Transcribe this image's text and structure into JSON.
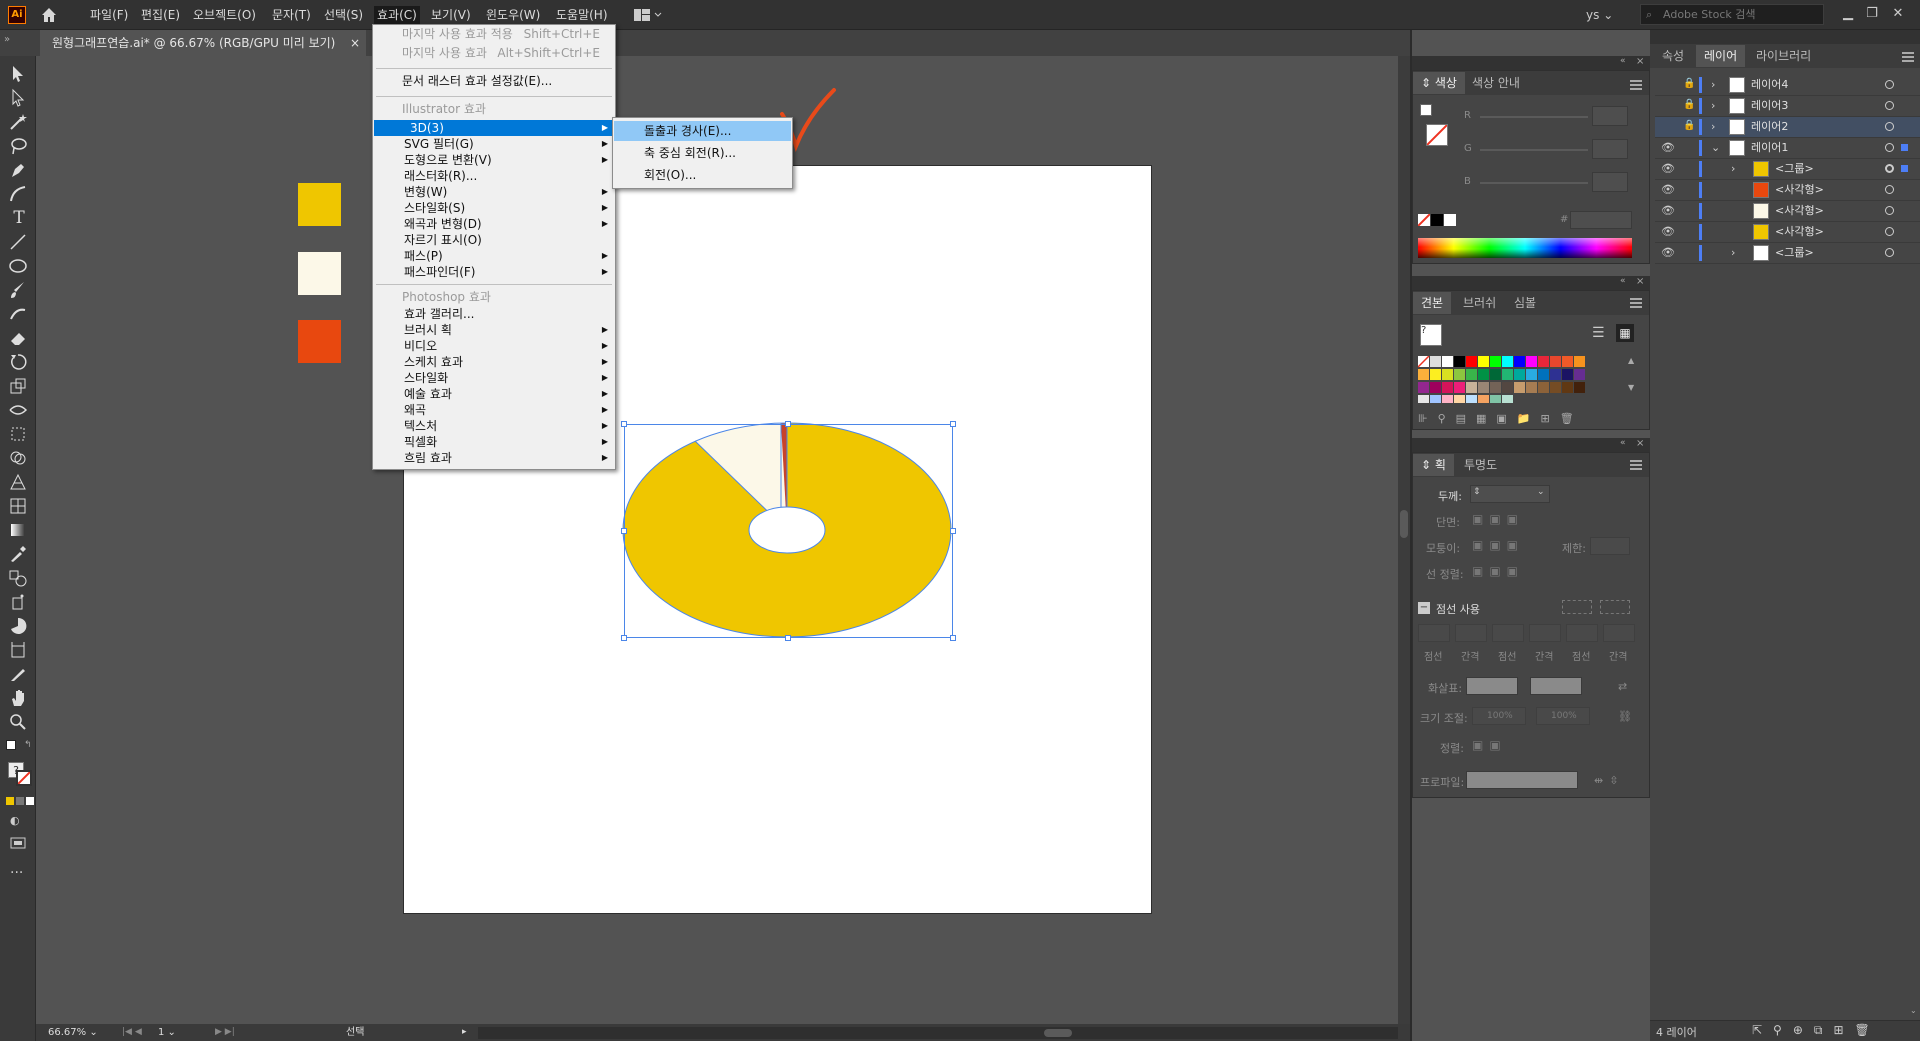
{
  "app": {
    "logo": "Ai"
  },
  "menubar": {
    "items": [
      "파일(F)",
      "편집(E)",
      "오브젝트(O)",
      "문자(T)",
      "선택(S)",
      "효과(C)",
      "보기(V)",
      "윈도우(W)",
      "도움말(H)"
    ],
    "user": "ys",
    "stock_placeholder": "Adobe Stock 검색"
  },
  "document": {
    "tab_title": "원형그래프연습.ai* @ 66.67% (RGB/GPU 미리 보기)"
  },
  "effect_menu": {
    "last_effect_apply": "마지막 사용 효과 적용",
    "last_effect_apply_shortcut": "Shift+Ctrl+E",
    "last_effect": "마지막 사용 효과",
    "last_effect_shortcut": "Alt+Shift+Ctrl+E",
    "raster_settings": "문서 래스터 효과 설정값(E)...",
    "illustrator_header": "Illustrator 효과",
    "illustrator_items": [
      "3D(3)",
      "SVG 필터(G)",
      "도형으로 변환(V)",
      "래스터화(R)...",
      "변형(W)",
      "스타일화(S)",
      "왜곡과 변형(D)",
      "자르기 표시(O)",
      "패스(P)",
      "패스파인더(F)"
    ],
    "photoshop_header": "Photoshop 효과",
    "photoshop_items": [
      "효과 갤러리...",
      "브러시 획",
      "비디오",
      "스케치 효과",
      "스타일화",
      "예술 효과",
      "왜곡",
      "텍스처",
      "픽셀화",
      "흐림 효과"
    ]
  },
  "submenu_3d": {
    "items": [
      "돌출과 경사(E)...",
      "축 중심 회전(R)...",
      "회전(O)..."
    ]
  },
  "color_panel": {
    "tabs": [
      "색상",
      "색상 안내"
    ],
    "channels": [
      "R",
      "G",
      "B"
    ],
    "hex_prefix": "#"
  },
  "swatches_panel": {
    "tabs": [
      "견본",
      "브러쉬",
      "심볼"
    ]
  },
  "stroke_panel": {
    "tabs": [
      "획",
      "투명도"
    ],
    "weight_label": "두께:",
    "cap_label": "단면:",
    "corner_label": "모퉁이:",
    "limit_label": "제한:",
    "align_label": "선 정렬:",
    "dashed_label": "점선 사용",
    "dash_headers": [
      "점선",
      "간격",
      "점선",
      "간격",
      "점선",
      "간격"
    ],
    "arrow_label": "화살표:",
    "scale_label": "크기 조절:",
    "scale_values": [
      "100%",
      "100%"
    ],
    "align2_label": "정렬:",
    "profile_label": "프로파일:"
  },
  "right_top_tabs": [
    "속성",
    "레이어",
    "라이브러리"
  ],
  "layers": {
    "rows": [
      {
        "name": "레이어4",
        "locked": true
      },
      {
        "name": "레이어3",
        "locked": true
      },
      {
        "name": "레이어2",
        "locked": true
      },
      {
        "name": "레이어1",
        "locked": false
      },
      {
        "name": "<그룹>"
      },
      {
        "name": "<사각형>"
      },
      {
        "name": "<사각형>"
      },
      {
        "name": "<사각형>"
      },
      {
        "name": "<그룹>"
      }
    ],
    "footer": "4 레이어"
  },
  "status": {
    "zoom": "66.67%",
    "page": "1",
    "tool": "선택"
  },
  "colors": {
    "pie_yellow": "#efc600",
    "pie_cream": "#fcf8e8",
    "pie_red": "#c8422a",
    "swatch_orange": "#e8480f",
    "selection": "#4b86e8",
    "checkmark": "#e84a1a",
    "menu_highlight": "#0078d7"
  }
}
